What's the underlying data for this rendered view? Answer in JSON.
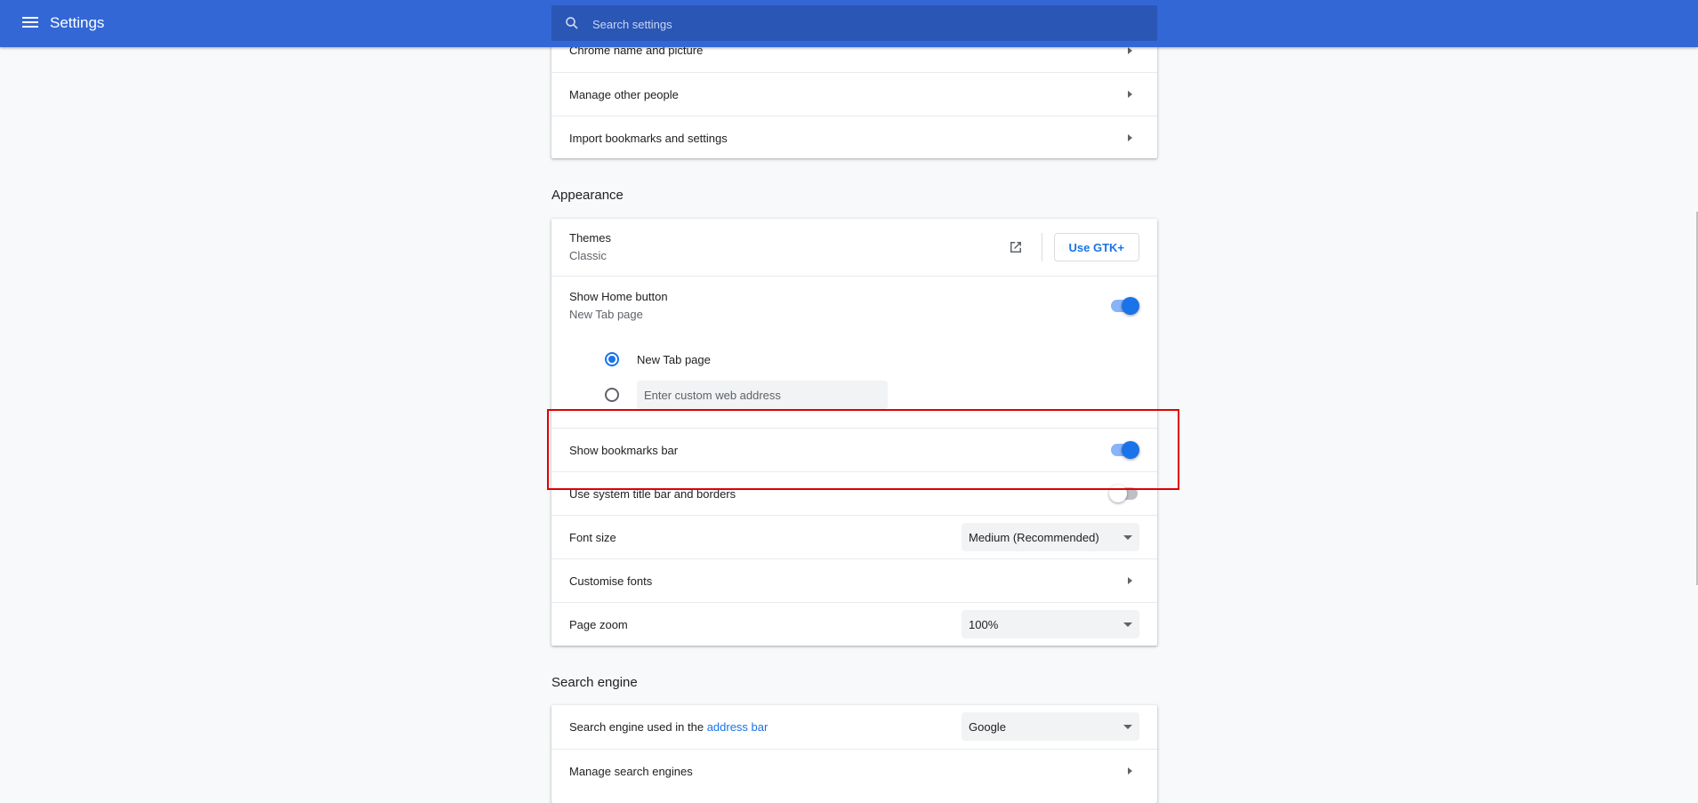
{
  "header": {
    "title": "Settings",
    "search_placeholder": "Search settings"
  },
  "people_rows": [
    {
      "label": "Chrome name and picture"
    },
    {
      "label": "Manage other people"
    },
    {
      "label": "Import bookmarks and settings"
    }
  ],
  "appearance": {
    "section_title": "Appearance",
    "themes": {
      "label": "Themes",
      "value": "Classic",
      "button": "Use GTK+"
    },
    "home_button": {
      "label": "Show Home button",
      "value": "New Tab page",
      "enabled": true,
      "option_new_tab": "New Tab page",
      "custom_placeholder": "Enter custom web address"
    },
    "bookmarks_bar": {
      "label": "Show bookmarks bar",
      "enabled": true
    },
    "system_title_bar": {
      "label": "Use system title bar and borders",
      "enabled": false
    },
    "font_size": {
      "label": "Font size",
      "value": "Medium (Recommended)"
    },
    "customise_fonts": {
      "label": "Customise fonts"
    },
    "page_zoom": {
      "label": "Page zoom",
      "value": "100%"
    }
  },
  "search_engine": {
    "section_title": "Search engine",
    "engine_row": {
      "label_prefix": "Search engine used in the",
      "link": "address bar",
      "value": "Google"
    },
    "manage_row": {
      "label": "Manage search engines"
    }
  },
  "colors": {
    "header_bg": "#3367d6",
    "accent": "#1a73e8",
    "highlight": "#e00000"
  },
  "icons": [
    "menu-icon",
    "search-icon",
    "external-link-icon",
    "chevron-right-icon",
    "dropdown-caret-icon"
  ]
}
